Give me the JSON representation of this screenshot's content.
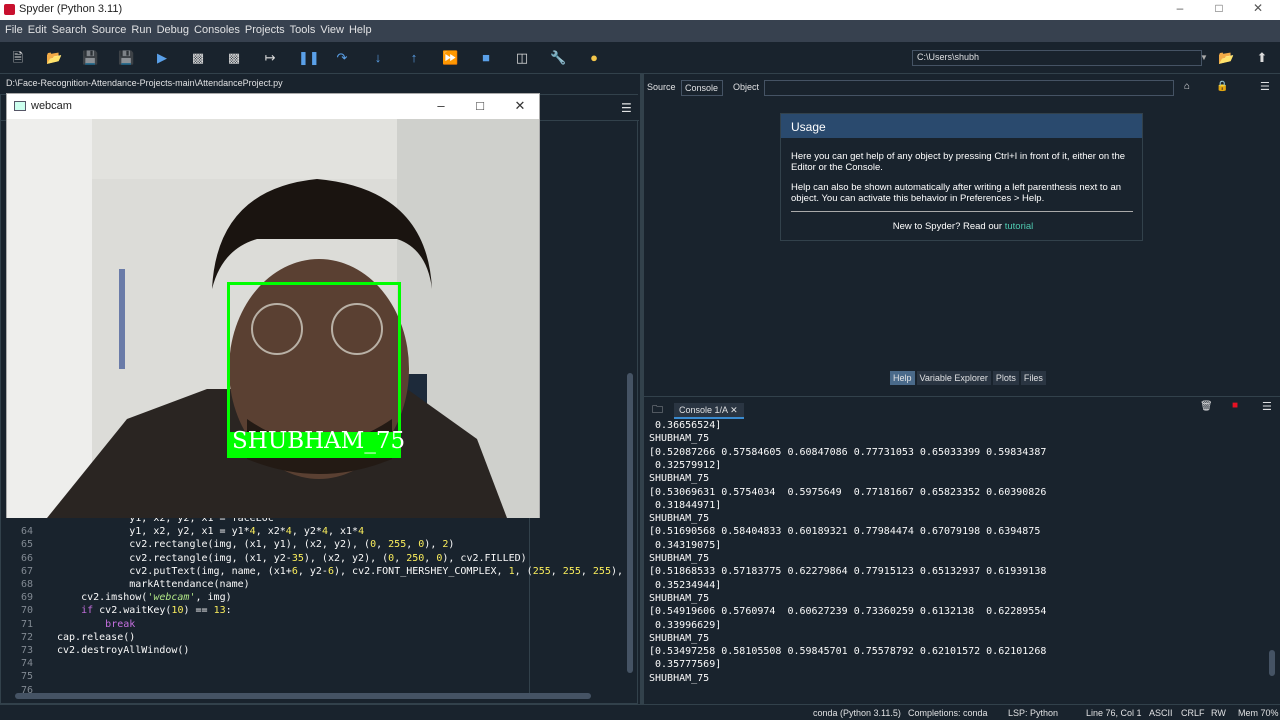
{
  "window": {
    "title": "Spyder (Python 3.11)"
  },
  "menu": [
    "File",
    "Edit",
    "Search",
    "Source",
    "Run",
    "Debug",
    "Consoles",
    "Projects",
    "Tools",
    "View",
    "Help"
  ],
  "path": {
    "value": "C:\\Users\\shubh"
  },
  "editor": {
    "file_path": "D:\\Face-Recognition-Attendance-Projects-main\\AttendanceProject.py",
    "lines": [
      {
        "n": "",
        "code": "            y1, x2, y2, x1 = faceLoc"
      },
      {
        "n": "64",
        "code": "            y1, x2, y2, x1 = y1*4, x2*4, y2*4, x1*4"
      },
      {
        "n": "65",
        "code": "            cv2.rectangle(img, (x1, y1), (x2, y2), (0, 255, 0), 2)"
      },
      {
        "n": "66",
        "code": "            cv2.rectangle(img, (x1, y2-35), (x2, y2), (0, 250, 0), cv2.FILLED)"
      },
      {
        "n": "67",
        "code": "            cv2.putText(img, name, (x1+6, y2-6), cv2.FONT_HERSHEY_COMPLEX, 1, (255, 255, 255),"
      },
      {
        "n": "68",
        "code": "            markAttendance(name)"
      },
      {
        "n": "69",
        "code": "    cv2.imshow('webcam', img)"
      },
      {
        "n": "70",
        "code": "    if cv2.waitKey(10) == 13:"
      },
      {
        "n": "71",
        "code": "        break"
      },
      {
        "n": "72",
        "code": "cap.release()"
      },
      {
        "n": "73",
        "code": "cv2.destroyAllWindow()"
      },
      {
        "n": "74",
        "code": ""
      },
      {
        "n": "75",
        "code": ""
      },
      {
        "n": "76",
        "code": ""
      }
    ]
  },
  "webcam": {
    "title": "webcam",
    "label": "SHUBHAM_75"
  },
  "help": {
    "source_label": "Source",
    "source_value": "Console",
    "object_label": "Object",
    "usage_title": "Usage",
    "p1": "Here you can get help of any object by pressing Ctrl+I in front of it, either on the Editor or the Console.",
    "p2": "Help can also be shown automatically after writing a left parenthesis next to an object. You can activate this behavior in Preferences > Help.",
    "p3_prefix": "New to Spyder? Read our ",
    "p3_link": "tutorial"
  },
  "pane_tabs": [
    "Help",
    "Variable Explorer",
    "Plots",
    "Files"
  ],
  "console": {
    "tab": "Console 1/A",
    "lines": [
      " 0.36656524]",
      "SHUBHAM_75",
      "[0.52087266 0.57584605 0.60847086 0.77731053 0.65033399 0.59834387",
      " 0.32579912]",
      "SHUBHAM_75",
      "[0.53069631 0.5754034  0.5975649  0.77181667 0.65823352 0.60390826",
      " 0.31844971]",
      "SHUBHAM_75",
      "[0.51690568 0.58404833 0.60189321 0.77984474 0.67079198 0.6394875",
      " 0.34319075]",
      "SHUBHAM_75",
      "[0.51868533 0.57183775 0.62279864 0.77915123 0.65132937 0.61939138",
      " 0.35234944]",
      "SHUBHAM_75",
      "[0.54919606 0.5760974  0.60627239 0.73360259 0.6132138  0.62289554",
      " 0.33996629]",
      "SHUBHAM_75",
      "[0.53497258 0.58105508 0.59845701 0.75578792 0.62101572 0.62101268",
      " 0.35777569]",
      "SHUBHAM_75"
    ]
  },
  "status": {
    "env": "conda (Python 3.11.5)",
    "completions": "Completions: conda",
    "lsp": "LSP: Python",
    "cursor": "Line 76, Col 1",
    "encoding": "ASCII",
    "eol": "CRLF",
    "perm": "RW",
    "mem": "Mem 70%"
  }
}
